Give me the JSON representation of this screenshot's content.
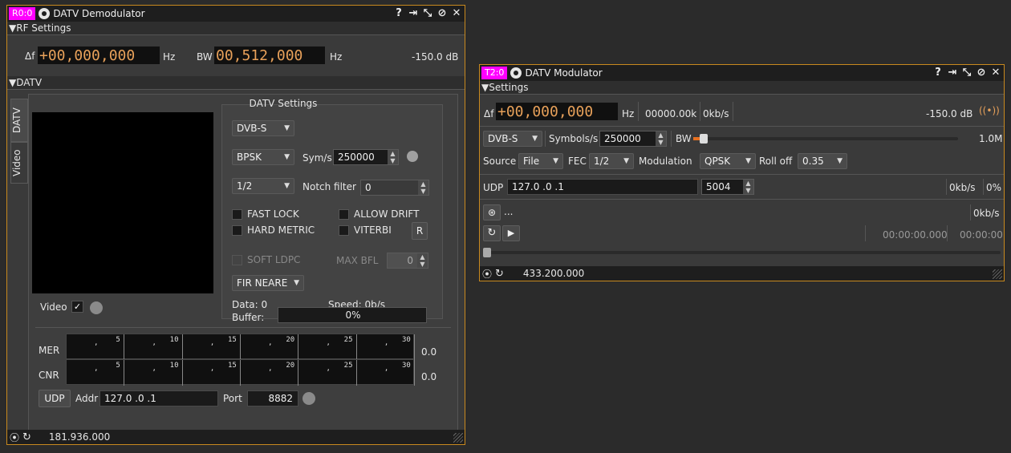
{
  "demod": {
    "tag": "R0:0",
    "title": "DATV Demodulator",
    "rf_section": "▼RF Settings",
    "delta_label": "Δf",
    "delta_value": "+00,000,000",
    "delta_unit": "Hz",
    "bw_label": "BW",
    "bw_value": "00,512,000",
    "bw_unit": "Hz",
    "power": "-150.0 dB",
    "datv_section": "▼DATV",
    "tab_datv": "DATV",
    "tab_video": "Video",
    "settings_title": "DATV Settings",
    "standard": "DVB-S",
    "modulation": "BPSK",
    "sym_label": "Sym/s",
    "sym_value": "250000",
    "fec": "1/2",
    "notch_label": "Notch filter",
    "notch_value": "0",
    "fast_lock": "FAST LOCK",
    "allow_drift": "ALLOW DRIFT",
    "hard_metric": "HARD METRIC",
    "viterbi": "VITERBI",
    "r_button": "R",
    "soft_ldpc": "SOFT LDPC",
    "max_bfl_label": "MAX BFL",
    "max_bfl_value": "0",
    "filter": "FIR NEARE",
    "data_label": "Data: 0",
    "speed_label": "Speed: 0b/s",
    "buffer_label": "Buffer:",
    "buffer_value": "0%",
    "buffer_fraction": 0.0,
    "video_label": "Video",
    "video_check": "✓",
    "mer_label": "MER",
    "mer_value": "0.0",
    "cnr_label": "CNR",
    "cnr_value": "0.0",
    "meter_ticks": [
      "5",
      "10",
      "15",
      "20",
      "25",
      "30"
    ],
    "udp_button": "UDP",
    "addr_label": "Addr",
    "addr_value": "127.0 .0 .1",
    "port_label": "Port",
    "port_value": "8882",
    "frequency": "181.936.000"
  },
  "mod": {
    "tag": "T2:0",
    "title": "DATV Modulator",
    "settings_section": "▼Settings",
    "delta_label": "Δf",
    "delta_value": "+00,000,000",
    "delta_unit": "Hz",
    "rate_k": "00000.00k",
    "rate_kbs": "0kb/s",
    "power": "-150.0 dB",
    "standard": "DVB-S",
    "symbols_label": "Symbols/s",
    "symbols_value": "250000",
    "bw_label": "BW",
    "bw_value": "1.0M",
    "source_label": "Source",
    "source_value": "File",
    "fec_label": "FEC",
    "fec_value": "1/2",
    "modulation_label": "Modulation",
    "modulation_value": "QPSK",
    "rolloff_label": "Roll off",
    "rolloff_value": "0.35",
    "udp_label": "UDP",
    "udp_addr": "127.0 .0 .1",
    "udp_port": "5004",
    "udp_rate": "0kb/s",
    "udp_pct": "0%",
    "file_name": "...",
    "file_rate": "0kb/s",
    "time_current": "00:00:00.000",
    "time_total": "00:00:00",
    "frequency": "433.200.000"
  },
  "colors": {
    "accent": "#c8891e",
    "tag": "#ff00ff",
    "dial_text": "#e8a15a",
    "bw_slider": "#e87020"
  }
}
